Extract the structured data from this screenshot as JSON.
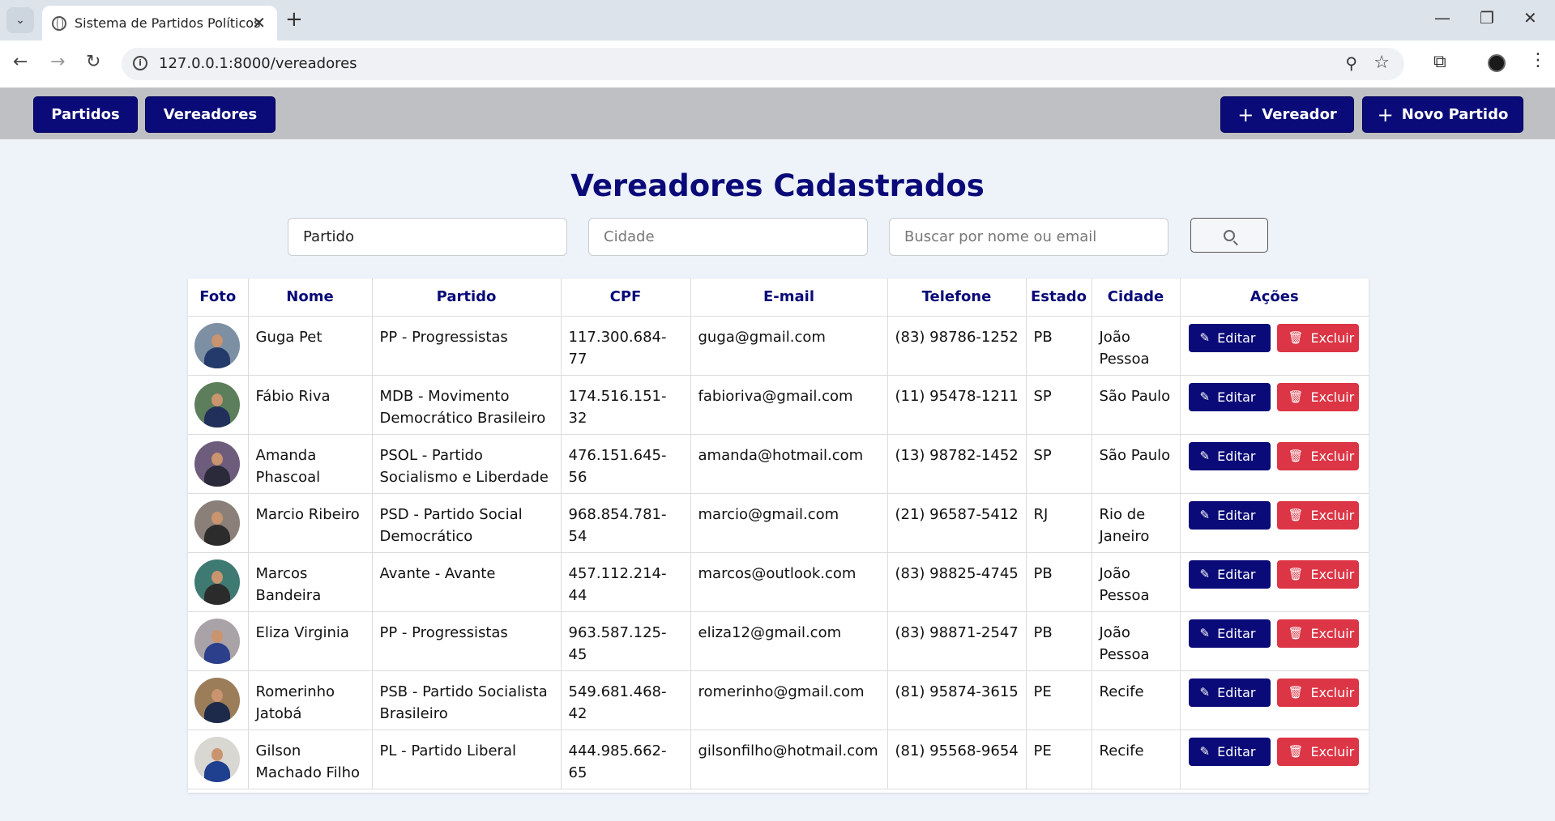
{
  "browser": {
    "tab_title": "Sistema de Partidos Políticos",
    "url": "127.0.0.1:8000/vereadores"
  },
  "nav": {
    "partidos": "Partidos",
    "vereadores": "Vereadores",
    "add_vereador": "Vereador",
    "novo_partido": "Novo Partido"
  },
  "page": {
    "title": "Vereadores Cadastrados"
  },
  "filters": {
    "partido_value": "Partido",
    "cidade_placeholder": "Cidade",
    "busca_placeholder": "Buscar por nome ou email"
  },
  "table": {
    "headers": [
      "Foto",
      "Nome",
      "Partido",
      "CPF",
      "E-mail",
      "Telefone",
      "Estado",
      "Cidade",
      "Ações"
    ],
    "edit_label": "Editar",
    "delete_label": "Excluir",
    "rows": [
      {
        "nome": "Guga Pet",
        "partido": "PP - Progressistas",
        "cpf": "117.300.684-77",
        "email": "guga@gmail.com",
        "telefone": "(83) 98786-1252",
        "estado": "PB",
        "cidade": "João Pessoa"
      },
      {
        "nome": "Fábio Riva",
        "partido": "MDB - Movimento Democrático Brasileiro",
        "cpf": "174.516.151-32",
        "email": "fabioriva@gmail.com",
        "telefone": "(11) 95478-1211",
        "estado": "SP",
        "cidade": "São Paulo"
      },
      {
        "nome": "Amanda Phascoal",
        "partido": "PSOL - Partido Socialismo e Liberdade",
        "cpf": "476.151.645-56",
        "email": "amanda@hotmail.com",
        "telefone": "(13) 98782-1452",
        "estado": "SP",
        "cidade": "São Paulo"
      },
      {
        "nome": "Marcio Ribeiro",
        "partido": "PSD - Partido Social Democrático",
        "cpf": "968.854.781-54",
        "email": "marcio@gmail.com",
        "telefone": "(21) 96587-5412",
        "estado": "RJ",
        "cidade": "Rio de Janeiro"
      },
      {
        "nome": "Marcos Bandeira",
        "partido": "Avante - Avante",
        "cpf": "457.112.214-44",
        "email": "marcos@outlook.com",
        "telefone": "(83) 98825-4745",
        "estado": "PB",
        "cidade": "João Pessoa"
      },
      {
        "nome": "Eliza Virginia",
        "partido": "PP - Progressistas",
        "cpf": "963.587.125-45",
        "email": "eliza12@gmail.com",
        "telefone": "(83) 98871-2547",
        "estado": "PB",
        "cidade": "João Pessoa"
      },
      {
        "nome": "Romerinho Jatobá",
        "partido": "PSB - Partido Socialista Brasileiro",
        "cpf": "549.681.468-42",
        "email": "romerinho@gmail.com",
        "telefone": "(81) 95874-3615",
        "estado": "PE",
        "cidade": "Recife"
      },
      {
        "nome": "Gilson Machado Filho",
        "partido": "PL - Partido Liberal",
        "cpf": "444.985.662-65",
        "email": "gilsonfilho@hotmail.com",
        "telefone": "(81) 95568-9654",
        "estado": "PE",
        "cidade": "Recife"
      }
    ]
  },
  "colors": {
    "primary": "#0a0a78",
    "danger": "#dc3545",
    "navbar": "#bfc0c3",
    "background": "#eef2f9"
  }
}
